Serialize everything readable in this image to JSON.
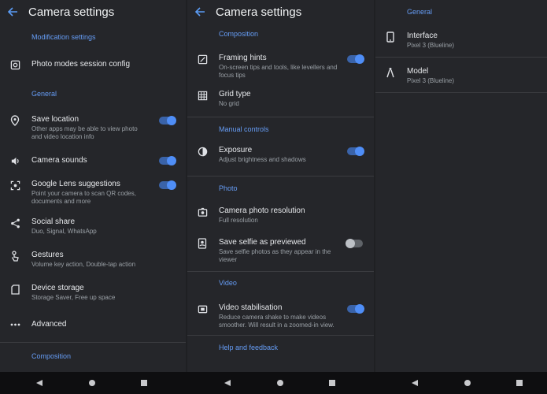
{
  "panel1": {
    "title": "Camera settings",
    "sections": {
      "modification": "Modification settings",
      "general": "General",
      "composition": "Composition"
    },
    "items": {
      "photo_modes": {
        "title": "Photo modes session config"
      },
      "save_location": {
        "title": "Save location",
        "subtitle": "Other apps may be able to view photo and video location info",
        "toggle": "on"
      },
      "camera_sounds": {
        "title": "Camera sounds",
        "toggle": "on"
      },
      "google_lens": {
        "title": "Google Lens suggestions",
        "subtitle": "Point your camera to scan QR codes, documents and more",
        "toggle": "on"
      },
      "social_share": {
        "title": "Social share",
        "subtitle": "Duo, Signal, WhatsApp"
      },
      "gestures": {
        "title": "Gestures",
        "subtitle": "Volume key action, Double-tap action"
      },
      "device_storage": {
        "title": "Device storage",
        "subtitle": "Storage Saver, Free up space"
      },
      "advanced": {
        "title": "Advanced"
      }
    }
  },
  "panel2": {
    "title": "Camera settings",
    "sections": {
      "composition": "Composition",
      "manual_controls": "Manual controls",
      "photo": "Photo",
      "video": "Video",
      "help": "Help and feedback"
    },
    "items": {
      "framing_hints": {
        "title": "Framing hints",
        "subtitle": "On-screen tips and tools, like levellers and focus tips",
        "toggle": "on"
      },
      "grid_type": {
        "title": "Grid type",
        "subtitle": "No grid"
      },
      "exposure": {
        "title": "Exposure",
        "subtitle": "Adjust brightness and shadows",
        "toggle": "on"
      },
      "photo_resolution": {
        "title": "Camera photo resolution",
        "subtitle": "Full resolution"
      },
      "save_selfie": {
        "title": "Save selfie as previewed",
        "subtitle": "Save selfie photos as they appear in the viewer",
        "toggle": "off"
      },
      "video_stabilisation": {
        "title": "Video stabilisation",
        "subtitle": "Reduce camera shake to make videos smoother. Will result in a zoomed-in view.",
        "toggle": "on"
      }
    }
  },
  "panel3": {
    "section": "General",
    "items": {
      "interface": {
        "title": "Interface",
        "subtitle": "Pixel 3 (Blueline)"
      },
      "model": {
        "title": "Model",
        "subtitle": "Pixel 3 (Blueline)"
      }
    }
  },
  "colors": {
    "accent": "#669df6",
    "background": "#25262a",
    "navbar": "#0e0e10"
  }
}
